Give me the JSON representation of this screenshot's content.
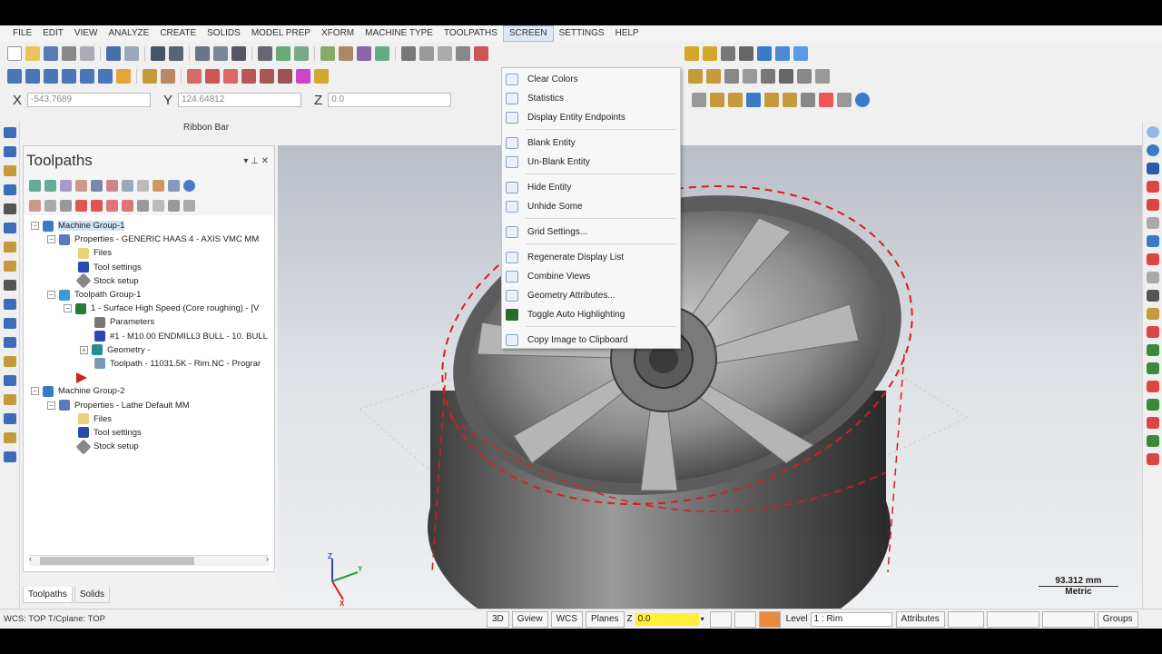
{
  "menu": {
    "items": [
      "FILE",
      "EDIT",
      "VIEW",
      "ANALYZE",
      "CREATE",
      "SOLIDS",
      "MODEL PREP",
      "XFORM",
      "MACHINE TYPE",
      "TOOLPATHS",
      "SCREEN",
      "SETTINGS",
      "HELP"
    ],
    "active": "SCREEN"
  },
  "coords": {
    "x_label": "X",
    "x_value": "-543.7689",
    "y_label": "Y",
    "y_value": "124.64812",
    "z_label": "Z",
    "z_value": "0.0"
  },
  "ribbon_bar_label": "Ribbon Bar",
  "panel": {
    "title": "Toolpaths",
    "pin_glyph": "▾ ⊥ ✕"
  },
  "tree": [
    {
      "label": "Machine Group-1",
      "selected": true
    },
    {
      "label": "Properties - GENERIC HAAS 4 - AXIS VMC MM"
    },
    {
      "label": "Files"
    },
    {
      "label": "Tool settings"
    },
    {
      "label": "Stock setup"
    },
    {
      "label": "Toolpath Group-1"
    },
    {
      "label": "1 - Surface High Speed (Core roughing) - [V"
    },
    {
      "label": "Parameters"
    },
    {
      "label": "#1 - M10.00 ENDMILL3 BULL - 10. BULL"
    },
    {
      "label": "Geometry -"
    },
    {
      "label": "Toolpath - 11031.5K - Rim.NC - Prograr"
    },
    {
      "label": "Machine Group-2"
    },
    {
      "label": "Properties - Lathe Default MM"
    },
    {
      "label": "Files"
    },
    {
      "label": "Tool settings"
    },
    {
      "label": "Stock setup"
    }
  ],
  "tabs": [
    "Toolpaths",
    "Solids"
  ],
  "dropdown": [
    {
      "label": "Clear Colors",
      "icon": "clear-colors-icon"
    },
    {
      "label": "Statistics",
      "icon": "statistics-icon"
    },
    {
      "label": "Display Entity Endpoints",
      "icon": "endpoints-icon"
    },
    {
      "label": "Blank Entity",
      "icon": "blank-entity-icon"
    },
    {
      "label": "Un-Blank Entity",
      "icon": "unblank-entity-icon"
    },
    {
      "label": "Hide Entity",
      "icon": "hide-entity-icon"
    },
    {
      "label": "Unhide Some",
      "icon": "unhide-some-icon"
    },
    {
      "label": "Grid Settings...",
      "icon": "grid-icon"
    },
    {
      "label": "Regenerate Display List",
      "icon": "regenerate-icon"
    },
    {
      "label": "Combine Views",
      "icon": "combine-views-icon"
    },
    {
      "label": "Geometry Attributes...",
      "icon": "geometry-attributes-icon"
    },
    {
      "label": "Toggle Auto Highlighting",
      "icon": "highlight-icon"
    },
    {
      "label": "Copy Image to Clipboard",
      "icon": "copy-image-icon"
    }
  ],
  "viewport": {
    "scale_value": "93.312 mm",
    "scale_unit": "Metric",
    "axis_x": "X",
    "axis_y": "Y",
    "axis_z": "Z"
  },
  "status": {
    "left_text": "WCS: TOP  T/Cplane: TOP",
    "btn_3d": "3D",
    "btn_gview": "Gview",
    "btn_wcs": "WCS",
    "btn_planes": "Planes",
    "z_label": "Z",
    "z_value": "0.0",
    "level_label": "Level",
    "level_value": "1 : Rim",
    "attributes": "Attributes",
    "groups": "Groups"
  },
  "colors": {
    "highlight_yellow": "#ffef3a",
    "toolpath_red": "#d42020",
    "selection_blue": "#cfe3f7"
  }
}
